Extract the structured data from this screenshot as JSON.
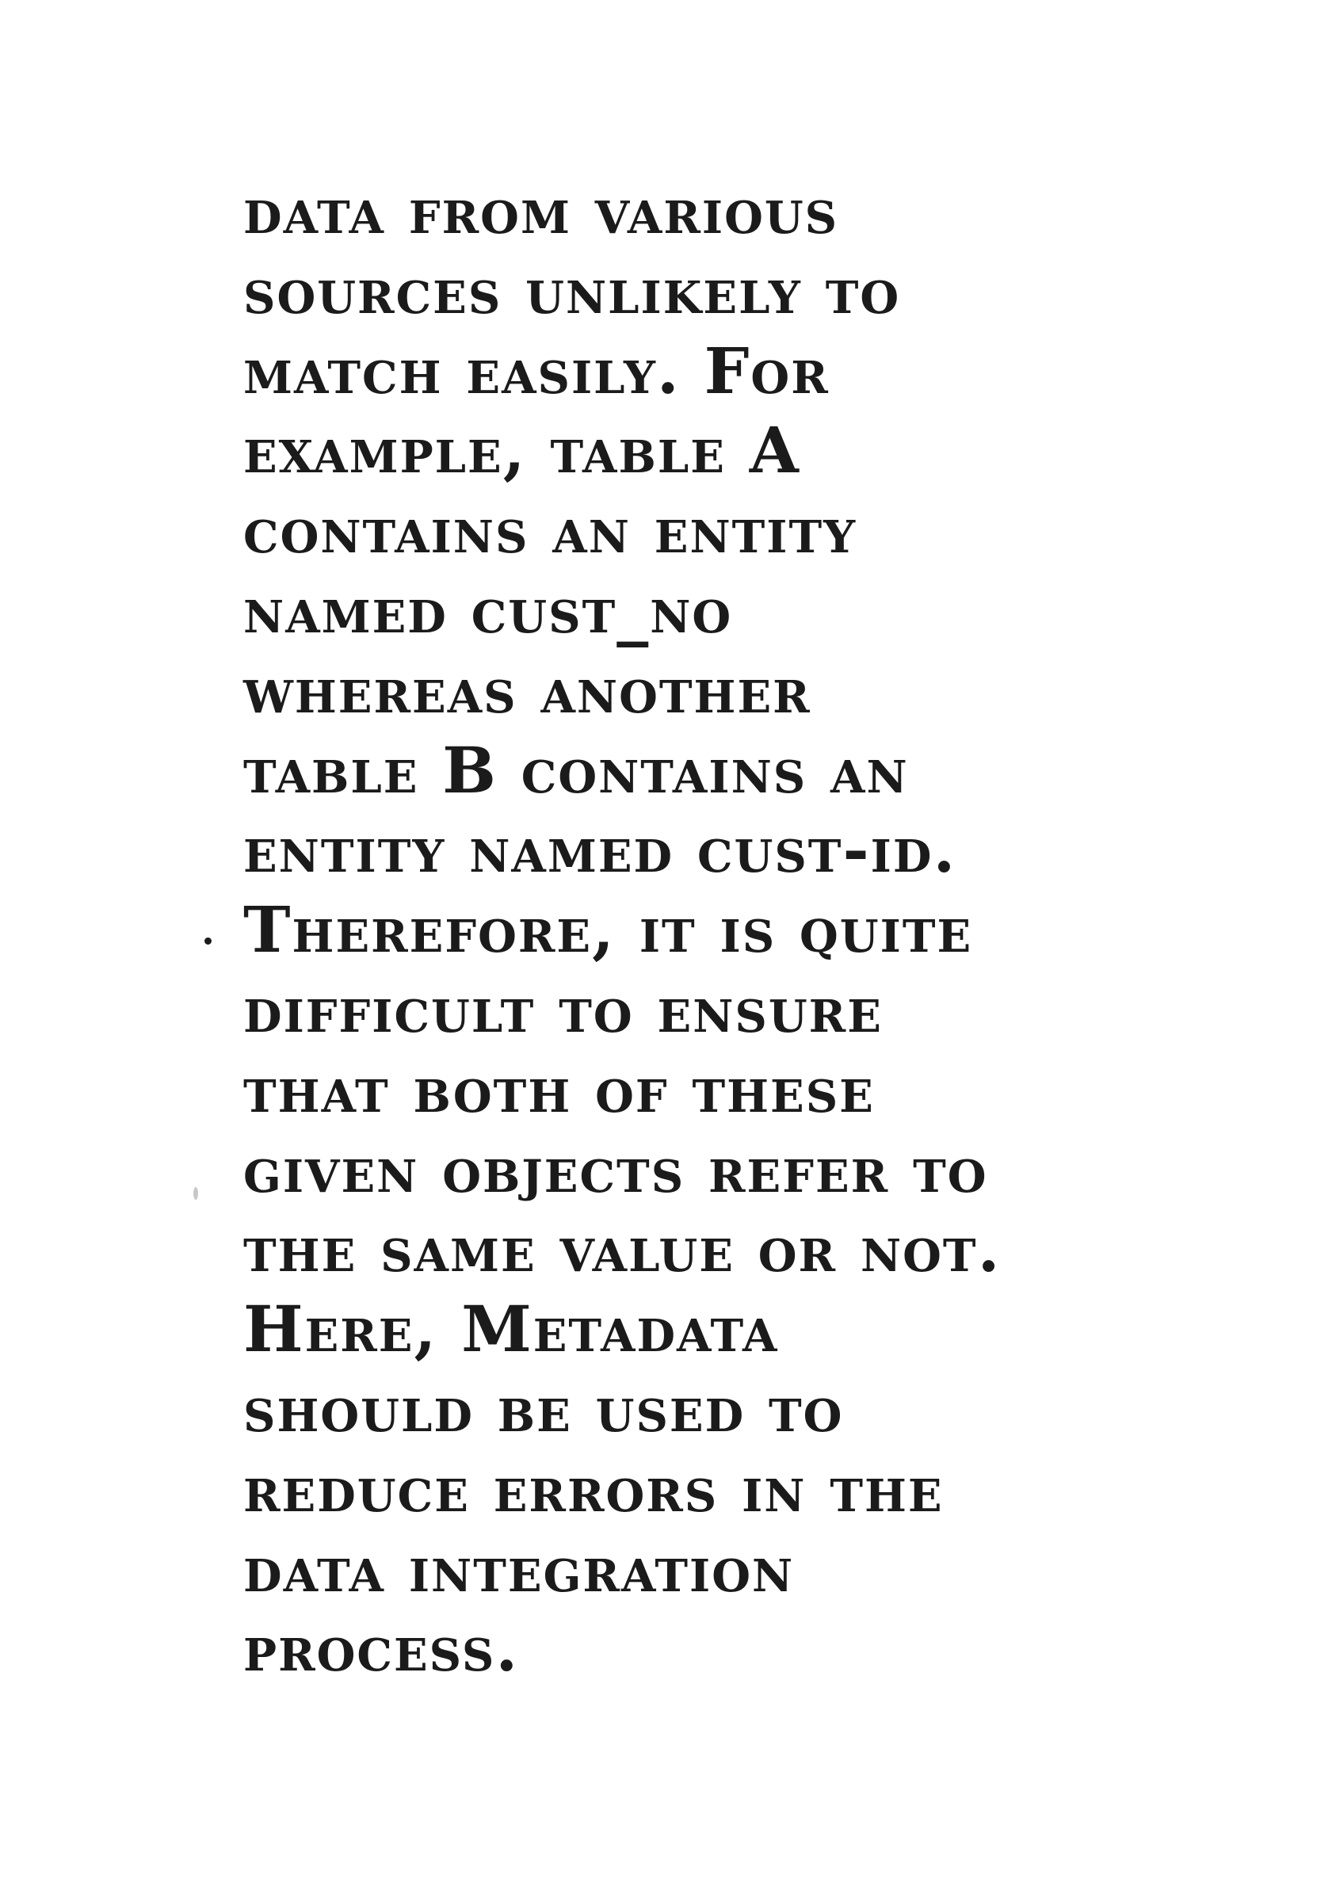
{
  "paragraph": {
    "lines": [
      "data from various",
      "sources unlikely to",
      "match easily. For",
      "example, table A",
      "contains an entity",
      "named cust_no",
      "whereas another",
      "table B contains an",
      "entity named cust-id.",
      "Therefore, it is quite",
      "difficult to ensure",
      "that both of these",
      "given objects refer to",
      "the same value or not.",
      "Here, Metadata",
      "should be used to",
      "reduce errors in the",
      "data integration",
      "process."
    ]
  }
}
